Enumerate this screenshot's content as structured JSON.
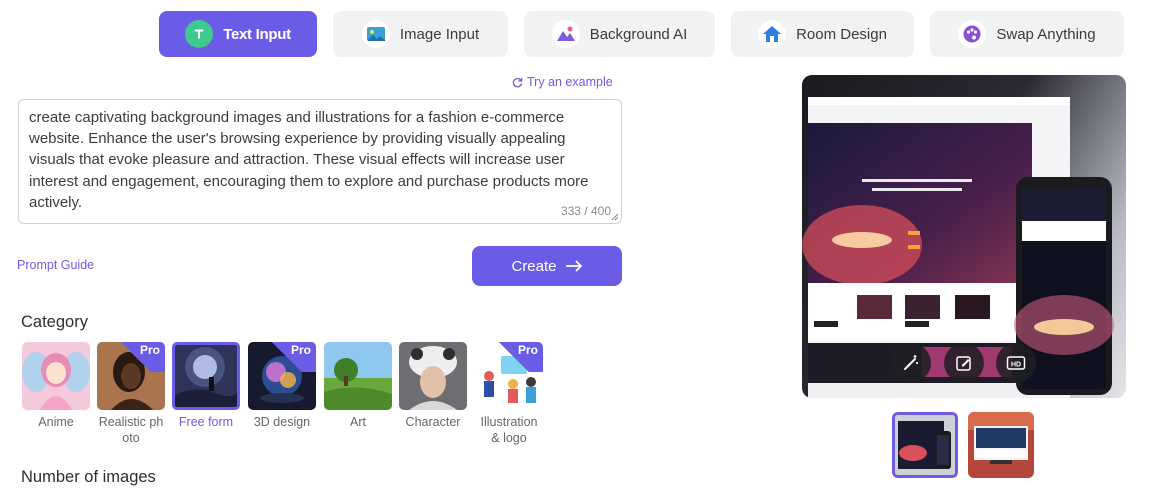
{
  "tabs": [
    {
      "label": "Text Input",
      "icon": "text-input-icon",
      "active": true
    },
    {
      "label": "Image Input",
      "icon": "image-input-icon",
      "active": false
    },
    {
      "label": "Background AI",
      "icon": "background-ai-icon",
      "active": false
    },
    {
      "label": "Room Design",
      "icon": "room-design-icon",
      "active": false
    },
    {
      "label": "Swap Anything",
      "icon": "swap-anything-icon",
      "active": false
    }
  ],
  "prompt": {
    "try_example": "Try an example",
    "text": "create captivating background images and illustrations for a fashion e-commerce website. Enhance the user's browsing experience by providing visually appealing visuals that evoke pleasure and attraction. These visual effects will increase user interest and engagement, encouraging them to explore and purchase products more actively.",
    "counter": "333 / 400"
  },
  "prompt_guide": "Prompt Guide",
  "create_button": "Create",
  "category": {
    "title": "Category",
    "items": [
      {
        "label": "Anime",
        "pro": false,
        "selected": false
      },
      {
        "label": "Realistic photo",
        "pro": true,
        "selected": false
      },
      {
        "label": "Free form",
        "pro": false,
        "selected": true
      },
      {
        "label": "3D design",
        "pro": true,
        "selected": false
      },
      {
        "label": "Art",
        "pro": false,
        "selected": false
      },
      {
        "label": "Character",
        "pro": false,
        "selected": false
      },
      {
        "label": "Illustration & logo",
        "pro": true,
        "selected": false
      }
    ],
    "pro_label": "Pro"
  },
  "number_of_images": {
    "title": "Number of images"
  },
  "preview": {
    "tools": [
      "magic-wand-icon",
      "edit-icon",
      "hd-icon"
    ],
    "thumbnails": 2,
    "accent": "#6b5ce7"
  }
}
